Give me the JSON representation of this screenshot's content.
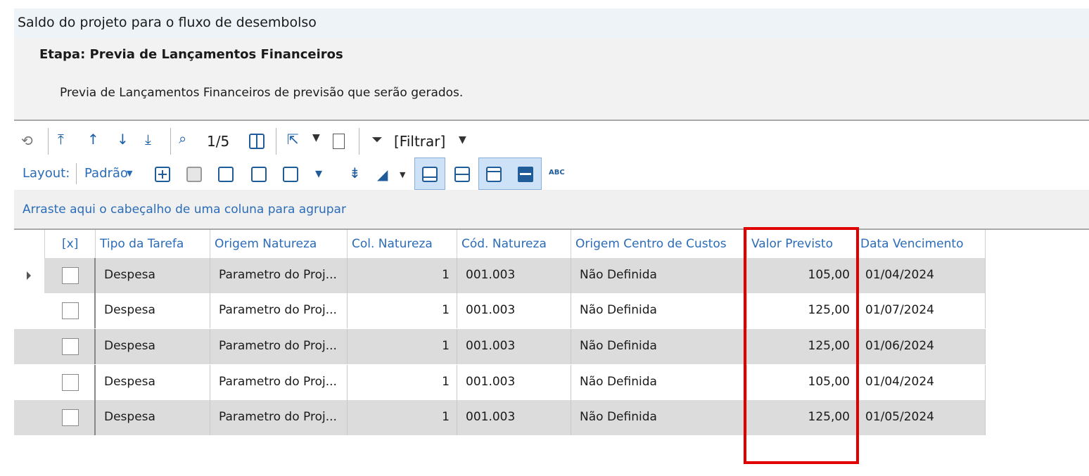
{
  "window": {
    "title": "Saldo do projeto para o fluxo de desembolso"
  },
  "step": {
    "title": "Etapa: Previa de Lançamentos Financeiros",
    "description": "Previa de Lançamentos Financeiros de previsão que serão gerados."
  },
  "toolbar": {
    "page_indicator": "1/5",
    "filter_label": "[Filtrar]",
    "layout_label": "Layout:",
    "layout_value": "Padrão",
    "abc_label": "ABC"
  },
  "groupbar": {
    "hint": "Arraste aqui o cabeçalho de uma coluna para agrupar"
  },
  "grid": {
    "columns": [
      "[x]",
      "Tipo da Tarefa",
      "Origem Natureza",
      "Col. Natureza",
      "Cód. Natureza",
      "Origem Centro de Custos",
      "Valor Previsto",
      "Data Vencimento"
    ],
    "rows": [
      {
        "tipo": "Despesa",
        "origem": "Parametro do Proj...",
        "col": "1",
        "cod": "001.003",
        "centro": "Não Definida",
        "valor": "105,00",
        "data": "01/04/2024"
      },
      {
        "tipo": "Despesa",
        "origem": "Parametro do Proj...",
        "col": "1",
        "cod": "001.003",
        "centro": "Não Definida",
        "valor": "125,00",
        "data": "01/07/2024"
      },
      {
        "tipo": "Despesa",
        "origem": "Parametro do Proj...",
        "col": "1",
        "cod": "001.003",
        "centro": "Não Definida",
        "valor": "125,00",
        "data": "01/06/2024"
      },
      {
        "tipo": "Despesa",
        "origem": "Parametro do Proj...",
        "col": "1",
        "cod": "001.003",
        "centro": "Não Definida",
        "valor": "105,00",
        "data": "01/04/2024"
      },
      {
        "tipo": "Despesa",
        "origem": "Parametro do Proj...",
        "col": "1",
        "cod": "001.003",
        "centro": "Não Definida",
        "valor": "125,00",
        "data": "01/05/2024"
      }
    ]
  },
  "colors": {
    "accent_blue": "#2b6cb8",
    "highlight_red": "#e00000",
    "alt_row": "#dcdcdc"
  }
}
